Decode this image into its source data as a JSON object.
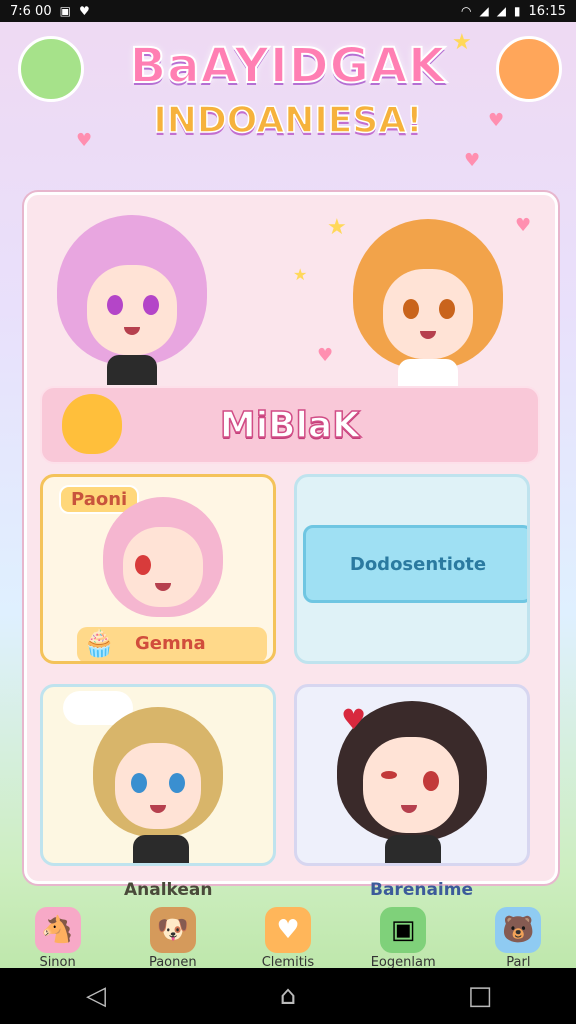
{
  "status_bar": {
    "left_time": "7:6 00",
    "right_time": "16:15"
  },
  "title": {
    "line1": "BaAYIDGAK",
    "line2": "INDOANIESA!"
  },
  "banner": {
    "label": "MiBlaK"
  },
  "cards": {
    "top_left": {
      "tag": "Paoni",
      "label": "Gemna"
    },
    "top_right": {
      "button_label": "Dodosentiote"
    },
    "bottom_left_label": "Analkean",
    "bottom_right_label": "Barenaime"
  },
  "tabs": [
    {
      "label": "Sinon",
      "icon": "pink-pony-icon"
    },
    {
      "label": "Paonen",
      "icon": "brown-dog-icon"
    },
    {
      "label": "Clemitis",
      "icon": "heart-badge-icon"
    },
    {
      "label": "Eogenlam",
      "icon": "green-box-icon"
    },
    {
      "label": "Parl",
      "icon": "blue-bear-icon"
    }
  ],
  "colors": {
    "accent_pink": "#ff7fb3",
    "accent_orange": "#f6b23c",
    "panel": "#fbe5ec"
  }
}
